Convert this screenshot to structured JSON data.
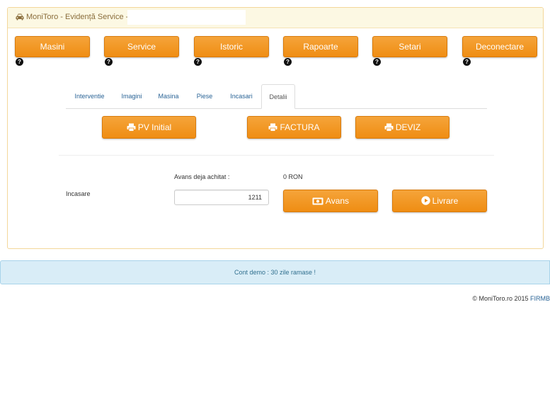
{
  "header": {
    "title": "MoniToro - Evidență Service -",
    "car_icon": "car-icon"
  },
  "nav": {
    "items": [
      {
        "label": "Masini"
      },
      {
        "label": "Service"
      },
      {
        "label": "Istoric"
      },
      {
        "label": "Rapoarte"
      },
      {
        "label": "Setari"
      },
      {
        "label": "Deconectare"
      }
    ],
    "help_glyph": "?"
  },
  "tabs": [
    {
      "label": "Interventie"
    },
    {
      "label": "Imagini"
    },
    {
      "label": "Masina"
    },
    {
      "label": "Piese"
    },
    {
      "label": "Incasari"
    },
    {
      "label": "Detalii",
      "active": true
    }
  ],
  "documents": {
    "pv_initial": "PV Initial",
    "factura": "FACTURA",
    "deviz": "DEVIZ",
    "icon": "print-icon"
  },
  "payment": {
    "section_label": "Incasare",
    "advance_label": "Avans deja achitat :",
    "advance_value": "0 RON",
    "amount_value": "1211",
    "avans_button": "Avans",
    "livrare_button": "Livrare"
  },
  "demo_notice": "Cont demo : 30 zile ramase !",
  "footer": {
    "copyright": "© MoniToro.ro 2015",
    "link": "FIRMB"
  },
  "colors": {
    "accent": "#f0931f",
    "header_bg": "#fcf8e3",
    "info_bg": "#d9edf7",
    "info_text": "#31708f",
    "link": "#2a6496"
  }
}
